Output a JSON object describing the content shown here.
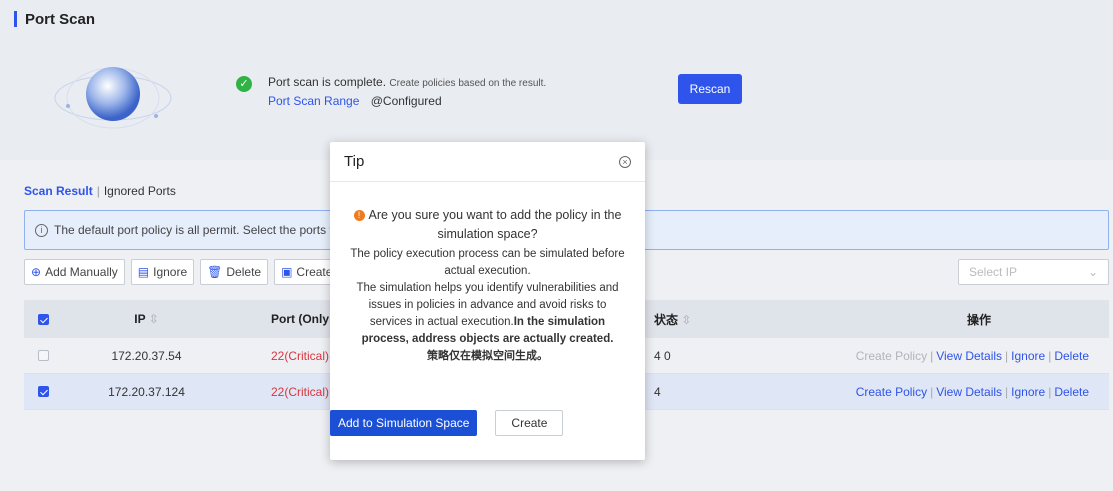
{
  "header": {
    "title": "Port Scan"
  },
  "scan": {
    "status_main": "Port scan is complete.",
    "status_sub": "Create policies based on the result.",
    "range_link": "Port Scan Range",
    "range_value": "@Configured",
    "rescan_label": "Rescan"
  },
  "tabs": {
    "active": "Scan Result",
    "other": "Ignored Ports"
  },
  "info": {
    "text": "The default port policy is all permit. Select the ports to"
  },
  "toolbar": {
    "add_manually": "Add Manually",
    "ignore": "Ignore",
    "delete": "Delete",
    "create": "Create P",
    "select_ip_placeholder": "Select IP"
  },
  "table": {
    "headers": {
      "ip": "IP",
      "port": "Port (Only Descr",
      "status": "状态",
      "ops": "操作"
    },
    "rows": [
      {
        "ip": "172.20.37.54",
        "port": "22(Critical),2",
        "status": "4 0",
        "checked": false
      },
      {
        "ip": "172.20.37.124",
        "port": "22(Critical),2",
        "status": "4",
        "checked": true
      }
    ],
    "ops": {
      "create_policy": "Create Policy",
      "view_details": "View Details",
      "ignore": "Ignore",
      "delete": "Delete",
      "sep": "|"
    }
  },
  "modal": {
    "title": "Tip",
    "question": "Are you sure you want to add the policy in the simulation space?",
    "line1": "The policy execution process can be simulated before actual execution.",
    "line2": "The simulation helps you identify vulnerabilities and issues in policies in advance and avoid risks to services in actual execution.",
    "line3_bold": "In the simulation process, address objects are actually created.",
    "line4_bold": "策略仅在模拟空间生成。",
    "primary_label": "Add to Simulation Space",
    "secondary_label": "Create"
  },
  "colors": {
    "accent": "#2f54eb",
    "critical": "#d9363e",
    "success": "#2fb344",
    "warning": "#f07b1d"
  },
  "icons": [
    "check-circle-icon",
    "globe-icon",
    "info-icon",
    "plus-circle-icon",
    "ignore-icon",
    "trash-icon",
    "create-icon",
    "chevron-down-icon",
    "sort-icon",
    "close-icon",
    "warning-icon"
  ]
}
